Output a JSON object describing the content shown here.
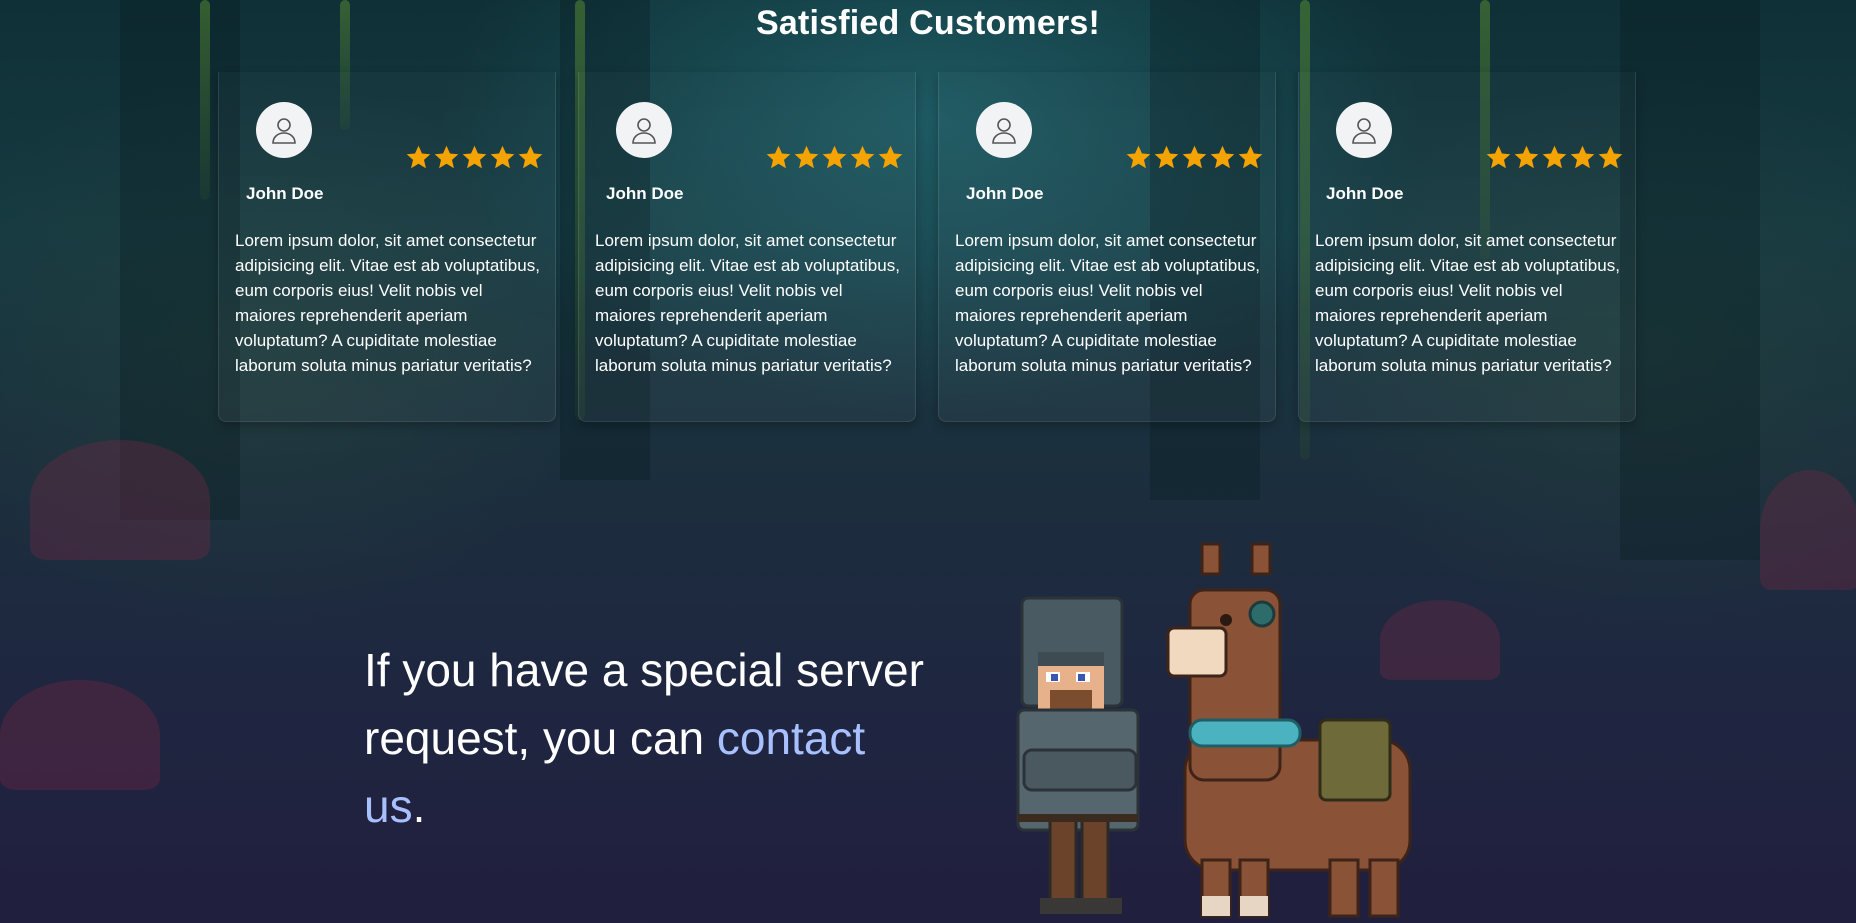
{
  "section_title": "Satisfied Customers!",
  "testimonials": [
    {
      "name": "John Doe",
      "rating": 5,
      "text": "Lorem ipsum dolor, sit amet consectetur adipisicing elit. Vitae est ab voluptatibus, eum corporis eius! Velit nobis vel maiores reprehenderit aperiam voluptatum? A cupiditate molestiae laborum soluta minus pariatur veritatis?"
    },
    {
      "name": "John Doe",
      "rating": 5,
      "text": "Lorem ipsum dolor, sit amet consectetur adipisicing elit. Vitae est ab voluptatibus, eum corporis eius! Velit nobis vel maiores reprehenderit aperiam voluptatum? A cupiditate molestiae laborum soluta minus pariatur veritatis?"
    },
    {
      "name": "John Doe",
      "rating": 5,
      "text": "Lorem ipsum dolor, sit amet consectetur adipisicing elit. Vitae est ab voluptatibus, eum corporis eius! Velit nobis vel maiores reprehenderit aperiam voluptatum? A cupiditate molestiae laborum soluta minus pariatur veritatis?"
    },
    {
      "name": "John Doe",
      "rating": 5,
      "text": "Lorem ipsum dolor, sit amet consectetur adipisicing elit. Vitae est ab voluptatibus, eum corporis eius! Velit nobis vel maiores reprehenderit aperiam voluptatum? A cupiditate molestiae laborum soluta minus pariatur veritatis?"
    }
  ],
  "cta": {
    "text_before": "If you have a special server request, you can",
    "link_text": "contact us",
    "text_after": "."
  },
  "colors": {
    "star": "#f5a300",
    "link": "#a9c0ff",
    "avatar_bg": "#f2f3f5"
  },
  "icons": {
    "avatar": "user-icon",
    "rating": "star-icon"
  }
}
